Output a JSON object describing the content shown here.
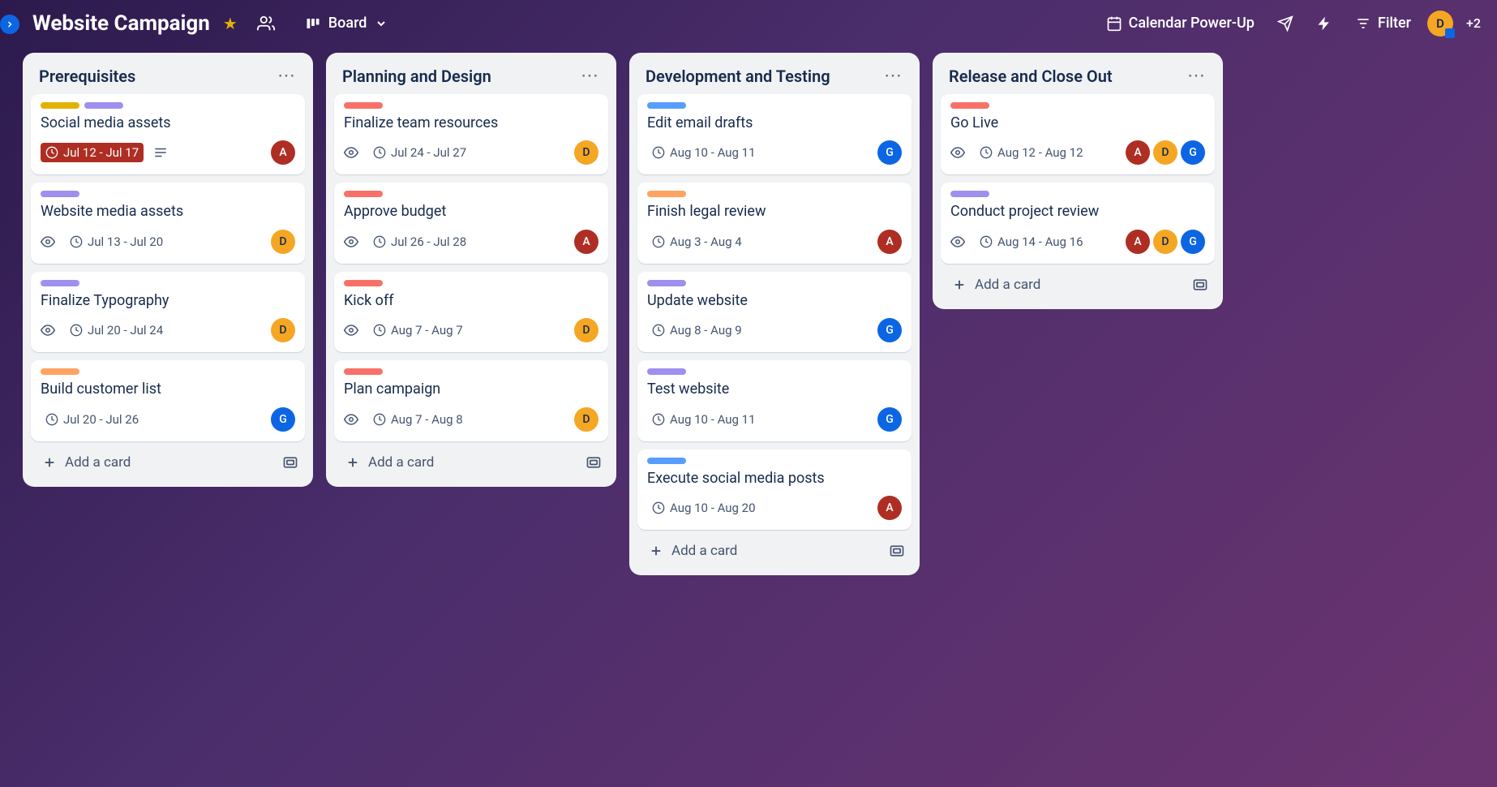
{
  "header": {
    "board_title": "Website Campaign",
    "view_label": "Board",
    "calendar_label": "Calendar Power-Up",
    "filter_label": "Filter",
    "avatar_initial": "D",
    "extra_label": "+2"
  },
  "colors": {
    "yellow": "#e2b203",
    "purple": "#9f8fef",
    "red": "#f87168",
    "orange": "#fea362",
    "blue": "#579dff"
  },
  "add_card_label": "Add a card",
  "lists": [
    {
      "title": "Prerequisites",
      "cards": [
        {
          "labels": [
            "yellow",
            "purple"
          ],
          "title": "Social media assets",
          "date": "Jul 12 - Jul 17",
          "overdue": true,
          "watch": false,
          "desc": true,
          "members": [
            "A"
          ]
        },
        {
          "labels": [
            "purple"
          ],
          "title": "Website media assets",
          "date": "Jul 13 - Jul 20",
          "overdue": false,
          "watch": true,
          "desc": false,
          "members": [
            "D"
          ]
        },
        {
          "labels": [
            "purple"
          ],
          "title": "Finalize Typography",
          "date": "Jul 20 - Jul 24",
          "overdue": false,
          "watch": true,
          "desc": false,
          "members": [
            "D"
          ]
        },
        {
          "labels": [
            "orange"
          ],
          "title": "Build customer list",
          "date": "Jul 20 - Jul 26",
          "overdue": false,
          "watch": false,
          "desc": false,
          "members": [
            "G"
          ]
        }
      ]
    },
    {
      "title": "Planning and Design",
      "cards": [
        {
          "labels": [
            "red"
          ],
          "title": "Finalize team resources",
          "date": "Jul 24 - Jul 27",
          "overdue": false,
          "watch": true,
          "desc": false,
          "members": [
            "D"
          ]
        },
        {
          "labels": [
            "red"
          ],
          "title": "Approve budget",
          "date": "Jul 26 - Jul 28",
          "overdue": false,
          "watch": true,
          "desc": false,
          "members": [
            "A"
          ]
        },
        {
          "labels": [
            "red"
          ],
          "title": "Kick off",
          "date": "Aug 7 - Aug 7",
          "overdue": false,
          "watch": true,
          "desc": false,
          "members": [
            "D"
          ]
        },
        {
          "labels": [
            "red"
          ],
          "title": "Plan campaign",
          "date": "Aug 7 - Aug 8",
          "overdue": false,
          "watch": true,
          "desc": false,
          "members": [
            "D"
          ]
        }
      ]
    },
    {
      "title": "Development and Testing",
      "cards": [
        {
          "labels": [
            "blue"
          ],
          "title": "Edit email drafts",
          "date": "Aug 10 - Aug 11",
          "overdue": false,
          "watch": false,
          "desc": false,
          "members": [
            "G"
          ]
        },
        {
          "labels": [
            "orange"
          ],
          "title": "Finish legal review",
          "date": "Aug 3 - Aug 4",
          "overdue": false,
          "watch": false,
          "desc": false,
          "members": [
            "A"
          ]
        },
        {
          "labels": [
            "purple"
          ],
          "title": "Update website",
          "date": "Aug 8 - Aug 9",
          "overdue": false,
          "watch": false,
          "desc": false,
          "members": [
            "G"
          ]
        },
        {
          "labels": [
            "purple"
          ],
          "title": "Test website",
          "date": "Aug 10 - Aug 11",
          "overdue": false,
          "watch": false,
          "desc": false,
          "members": [
            "G"
          ]
        },
        {
          "labels": [
            "blue"
          ],
          "title": "Execute social media posts",
          "date": "Aug 10 - Aug 20",
          "overdue": false,
          "watch": false,
          "desc": false,
          "members": [
            "A"
          ]
        }
      ]
    },
    {
      "title": "Release and Close Out",
      "cards": [
        {
          "labels": [
            "red"
          ],
          "title": "Go Live",
          "date": "Aug 12 - Aug 12",
          "overdue": false,
          "watch": true,
          "desc": false,
          "members": [
            "A",
            "D",
            "G"
          ]
        },
        {
          "labels": [
            "purple"
          ],
          "title": "Conduct project review",
          "date": "Aug 14 - Aug 16",
          "overdue": false,
          "watch": true,
          "desc": false,
          "members": [
            "A",
            "D",
            "G"
          ]
        }
      ]
    }
  ]
}
